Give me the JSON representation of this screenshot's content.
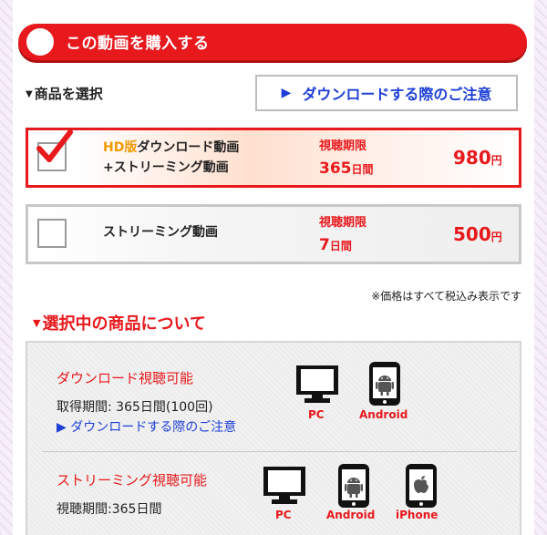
{
  "header": {
    "title": "この動画を購入する"
  },
  "product_select": {
    "label": "商品を選択",
    "notice_button": "ダウンロードする際のご注意"
  },
  "options": [
    {
      "name_hd": "HD版",
      "name_line1": "ダウンロード動画",
      "name_line2": "+ストリーミング動画",
      "period_label": "視聴期限",
      "period_value": "365",
      "period_unit": "日間",
      "price": "980",
      "currency": "円",
      "selected": true
    },
    {
      "name_line1": "ストリーミング動画",
      "period_label": "視聴期限",
      "period_value": "7",
      "period_unit": "日間",
      "price": "500",
      "currency": "円",
      "selected": false
    }
  ],
  "tax_note": "※価格はすべて税込み表示です",
  "selected_info": {
    "title": "選択中の商品について",
    "download": {
      "title": "ダウンロード視聴可能",
      "period_text": "取得期間: 365日間(100回)",
      "notice_link": "ダウンロードする際のご注意",
      "devices": [
        {
          "icon": "pc-monitor-icon",
          "label": "PC"
        },
        {
          "icon": "android-phone-icon",
          "label": "Android"
        }
      ]
    },
    "streaming": {
      "title": "ストリーミング視聴可能",
      "period_text": "視聴期間:365日間",
      "devices": [
        {
          "icon": "pc-monitor-icon",
          "label": "PC"
        },
        {
          "icon": "android-phone-icon",
          "label": "Android"
        },
        {
          "icon": "iphone-icon",
          "label": "iPhone"
        }
      ]
    }
  },
  "colors": {
    "accent": "#e8191d",
    "link": "#1e3fd6",
    "hd_orange": "#f39800"
  }
}
